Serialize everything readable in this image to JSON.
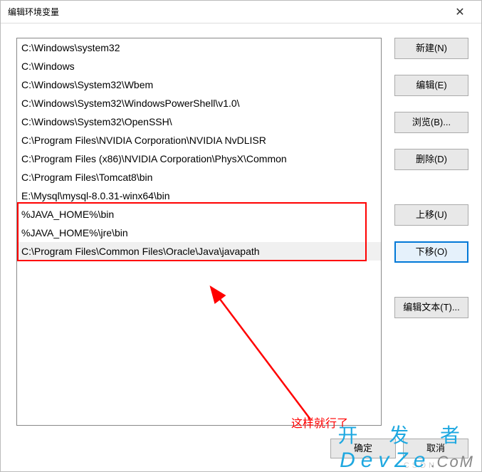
{
  "window": {
    "title": "编辑环境变量"
  },
  "list": {
    "items": [
      "C:\\Windows\\system32",
      "C:\\Windows",
      "C:\\Windows\\System32\\Wbem",
      "C:\\Windows\\System32\\WindowsPowerShell\\v1.0\\",
      "C:\\Windows\\System32\\OpenSSH\\",
      "C:\\Program Files\\NVIDIA Corporation\\NVIDIA NvDLISR",
      "C:\\Program Files (x86)\\NVIDIA Corporation\\PhysX\\Common",
      "C:\\Program Files\\Tomcat8\\bin",
      "E:\\Mysql\\mysql-8.0.31-winx64\\bin",
      "%JAVA_HOME%\\bin",
      "%JAVA_HOME%\\jre\\bin",
      "C:\\Program Files\\Common Files\\Oracle\\Java\\javapath"
    ],
    "selected_index": 11
  },
  "buttons": {
    "new": "新建(N)",
    "edit": "编辑(E)",
    "browse": "浏览(B)...",
    "delete": "删除(D)",
    "move_up": "上移(U)",
    "move_down": "下移(O)",
    "edit_text": "编辑文本(T)...",
    "ok": "确定",
    "cancel": "取消"
  },
  "annotation": {
    "text": "这样就行了"
  },
  "watermark": {
    "csdn": "CSDN",
    "kaifa": "开 发 者",
    "devze": "DevZe",
    "devze_suffix": ".CoM"
  }
}
